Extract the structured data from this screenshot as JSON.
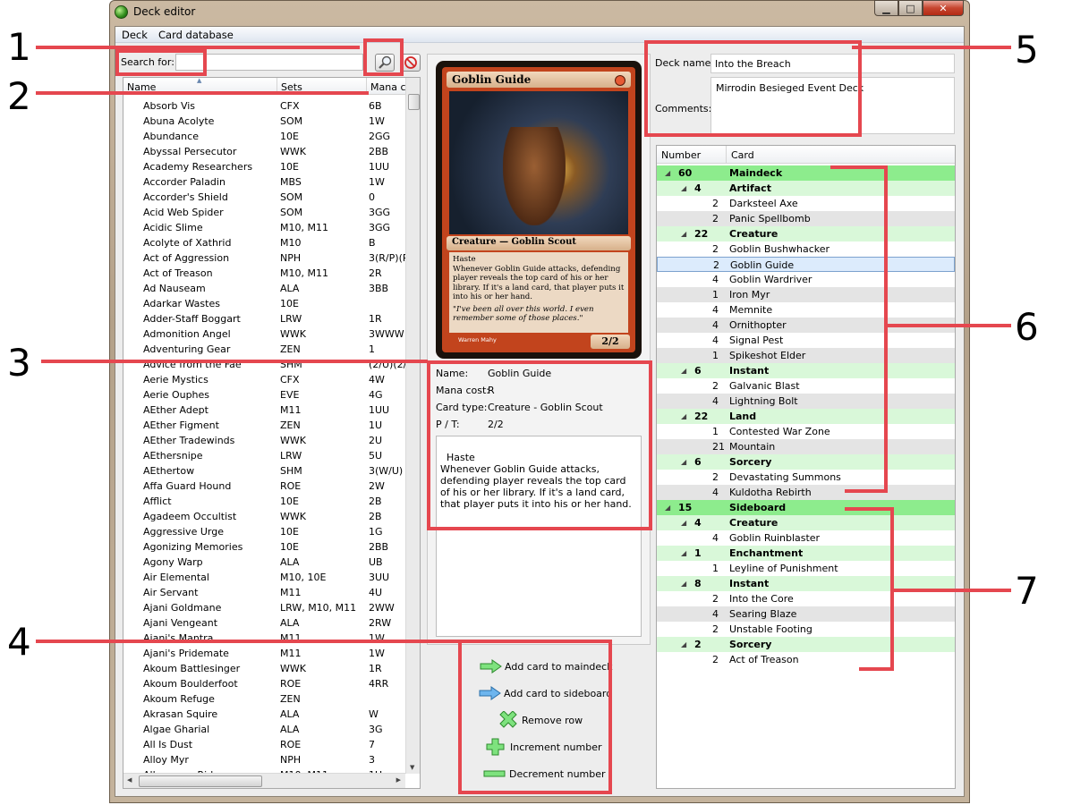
{
  "window": {
    "title": "Deck editor",
    "min_glyph": "▁",
    "max_glyph": "□",
    "close_glyph": "✕"
  },
  "menu": [
    "Deck",
    "Card database"
  ],
  "search": {
    "label": "Search for:",
    "value": ""
  },
  "db_table": {
    "headers": [
      "Name",
      "Sets",
      "Mana c"
    ],
    "rows": [
      [
        "Absorb Vis",
        "CFX",
        "6B"
      ],
      [
        "Abuna Acolyte",
        "SOM",
        "1W"
      ],
      [
        "Abundance",
        "10E",
        "2GG"
      ],
      [
        "Abyssal Persecutor",
        "WWK",
        "2BB"
      ],
      [
        "Academy Researchers",
        "10E",
        "1UU"
      ],
      [
        "Accorder Paladin",
        "MBS",
        "1W"
      ],
      [
        "Accorder's Shield",
        "SOM",
        "0"
      ],
      [
        "Acid Web Spider",
        "SOM",
        "3GG"
      ],
      [
        "Acidic Slime",
        "M10, M11",
        "3GG"
      ],
      [
        "Acolyte of Xathrid",
        "M10",
        "B"
      ],
      [
        "Act of Aggression",
        "NPH",
        "3(R/P)(R"
      ],
      [
        "Act of Treason",
        "M10, M11",
        "2R"
      ],
      [
        "Ad Nauseam",
        "ALA",
        "3BB"
      ],
      [
        "Adarkar Wastes",
        "10E",
        ""
      ],
      [
        "Adder-Staff Boggart",
        "LRW",
        "1R"
      ],
      [
        "Admonition Angel",
        "WWK",
        "3WWW"
      ],
      [
        "Adventuring Gear",
        "ZEN",
        "1"
      ],
      [
        "Advice from the Fae",
        "SHM",
        "(2/U)(2/"
      ],
      [
        "Aerie Mystics",
        "CFX",
        "4W"
      ],
      [
        "Aerie Ouphes",
        "EVE",
        "4G"
      ],
      [
        "AEther Adept",
        "M11",
        "1UU"
      ],
      [
        "AEther Figment",
        "ZEN",
        "1U"
      ],
      [
        "AEther Tradewinds",
        "WWK",
        "2U"
      ],
      [
        "AEthersnipe",
        "LRW",
        "5U"
      ],
      [
        "AEthertow",
        "SHM",
        "3(W/U)"
      ],
      [
        "Affa Guard Hound",
        "ROE",
        "2W"
      ],
      [
        "Afflict",
        "10E",
        "2B"
      ],
      [
        "Agadeem Occultist",
        "WWK",
        "2B"
      ],
      [
        "Aggressive Urge",
        "10E",
        "1G"
      ],
      [
        "Agonizing Memories",
        "10E",
        "2BB"
      ],
      [
        "Agony Warp",
        "ALA",
        "UB"
      ],
      [
        "Air Elemental",
        "M10, 10E",
        "3UU"
      ],
      [
        "Air Servant",
        "M11",
        "4U"
      ],
      [
        "Ajani Goldmane",
        "LRW, M10, M11",
        "2WW"
      ],
      [
        "Ajani Vengeant",
        "ALA",
        "2RW"
      ],
      [
        "Ajani's Mantra",
        "M11",
        "1W"
      ],
      [
        "Ajani's Pridemate",
        "M11",
        "1W"
      ],
      [
        "Akoum Battlesinger",
        "WWK",
        "1R"
      ],
      [
        "Akoum Boulderfoot",
        "ROE",
        "4RR"
      ],
      [
        "Akoum Refuge",
        "ZEN",
        ""
      ],
      [
        "Akrasan Squire",
        "ALA",
        "W"
      ],
      [
        "Algae Gharial",
        "ALA",
        "3G"
      ],
      [
        "All Is Dust",
        "ROE",
        "7"
      ],
      [
        "Alloy Myr",
        "NPH",
        "3"
      ]
    ],
    "partial_row": [
      "Allosaurus Rider",
      "M10, M11",
      "1U"
    ],
    "sort_indicator": "▲"
  },
  "card": {
    "image_name": "Goblin Guide",
    "image_type": "Creature — Goblin Scout",
    "image_rules": [
      "Haste",
      "Whenever Goblin Guide attacks, defending player reveals the top card of his or her library. If it's a land card, that player puts it into his or her hand."
    ],
    "image_flavor": "\"I've been all over this world. I even remember some of those places.\"",
    "image_artist": "Warren Mahy",
    "image_pt": "2/2",
    "fields": [
      {
        "label": "Name:",
        "value": "Goblin Guide"
      },
      {
        "label": "Mana cost:",
        "value": "R"
      },
      {
        "label": "Card type:",
        "value": "Creature - Goblin Scout"
      },
      {
        "label": "P / T:",
        "value": "2/2"
      }
    ],
    "text": "Haste\nWhenever Goblin Guide attacks, defending player reveals the top card of his or her library. If it's a land card, that player puts it into his or her hand."
  },
  "actions": [
    {
      "label": "Add card to maindeck",
      "icon": "green-arrow-icon"
    },
    {
      "label": "Add card to sideboard",
      "icon": "blue-arrow-icon"
    },
    {
      "label": "Remove row",
      "icon": "remove-x-icon"
    },
    {
      "label": "Increment number",
      "icon": "plus-icon"
    },
    {
      "label": "Decrement number",
      "icon": "minus-icon"
    }
  ],
  "deck": {
    "name_label": "Deck name:",
    "name": "Into the Breach",
    "comments_label": "Comments:",
    "comments": "Mirrodin Besieged Event Deck"
  },
  "deck_tree": {
    "headers": [
      "Number",
      "Card"
    ],
    "rows": [
      {
        "level": 0,
        "num": "60",
        "name": "Maindeck"
      },
      {
        "level": 1,
        "num": "4",
        "name": "Artifact"
      },
      {
        "level": 2,
        "num": "2",
        "name": "Darksteel Axe"
      },
      {
        "level": 2,
        "num": "2",
        "name": "Panic Spellbomb",
        "alt": true
      },
      {
        "level": 1,
        "num": "22",
        "name": "Creature"
      },
      {
        "level": 2,
        "num": "2",
        "name": "Goblin Bushwhacker"
      },
      {
        "level": 2,
        "num": "2",
        "name": "Goblin Guide",
        "selected": true
      },
      {
        "level": 2,
        "num": "4",
        "name": "Goblin Wardriver"
      },
      {
        "level": 2,
        "num": "1",
        "name": "Iron Myr",
        "alt": true
      },
      {
        "level": 2,
        "num": "4",
        "name": "Memnite"
      },
      {
        "level": 2,
        "num": "4",
        "name": "Ornithopter",
        "alt": true
      },
      {
        "level": 2,
        "num": "4",
        "name": "Signal Pest"
      },
      {
        "level": 2,
        "num": "1",
        "name": "Spikeshot Elder",
        "alt": true
      },
      {
        "level": 1,
        "num": "6",
        "name": "Instant"
      },
      {
        "level": 2,
        "num": "2",
        "name": "Galvanic Blast"
      },
      {
        "level": 2,
        "num": "4",
        "name": "Lightning Bolt",
        "alt": true
      },
      {
        "level": 1,
        "num": "22",
        "name": "Land"
      },
      {
        "level": 2,
        "num": "1",
        "name": "Contested War Zone"
      },
      {
        "level": 2,
        "num": "21",
        "name": "Mountain",
        "alt": true
      },
      {
        "level": 1,
        "num": "6",
        "name": "Sorcery"
      },
      {
        "level": 2,
        "num": "2",
        "name": "Devastating Summons"
      },
      {
        "level": 2,
        "num": "4",
        "name": "Kuldotha Rebirth",
        "alt": true
      },
      {
        "level": 0,
        "num": "15",
        "name": "Sideboard"
      },
      {
        "level": 1,
        "num": "4",
        "name": "Creature"
      },
      {
        "level": 2,
        "num": "4",
        "name": "Goblin Ruinblaster"
      },
      {
        "level": 1,
        "num": "1",
        "name": "Enchantment"
      },
      {
        "level": 2,
        "num": "1",
        "name": "Leyline of Punishment"
      },
      {
        "level": 1,
        "num": "8",
        "name": "Instant"
      },
      {
        "level": 2,
        "num": "2",
        "name": "Into the Core"
      },
      {
        "level": 2,
        "num": "4",
        "name": "Searing Blaze",
        "alt": true
      },
      {
        "level": 2,
        "num": "2",
        "name": "Unstable Footing"
      },
      {
        "level": 1,
        "num": "2",
        "name": "Sorcery"
      },
      {
        "level": 2,
        "num": "2",
        "name": "Act of Treason"
      }
    ]
  },
  "annotations": [
    "1",
    "2",
    "3",
    "4",
    "5",
    "6",
    "7"
  ],
  "colors": {
    "annotation": "#e5474f",
    "maindeck_bg": "#8dec8d",
    "group_bg": "#d9f8d9",
    "close_button": "#c6452f"
  }
}
